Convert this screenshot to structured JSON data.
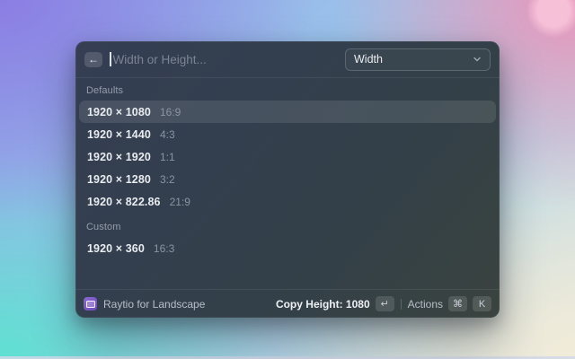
{
  "window": {
    "header": {
      "back_icon": "←",
      "search_placeholder": "Width or Height...",
      "dropdown": {
        "value": "Width"
      }
    },
    "sections": [
      {
        "label": "Defaults",
        "items": [
          {
            "size": "1920 × 1080",
            "ratio": "16:9",
            "selected": true
          },
          {
            "size": "1920 × 1440",
            "ratio": "4:3",
            "selected": false
          },
          {
            "size": "1920 × 1920",
            "ratio": "1:1",
            "selected": false
          },
          {
            "size": "1920 × 1280",
            "ratio": "3:2",
            "selected": false
          },
          {
            "size": "1920 × 822.86",
            "ratio": "21:9",
            "selected": false
          }
        ]
      },
      {
        "label": "Custom",
        "items": [
          {
            "size": "1920 × 360",
            "ratio": "16:3",
            "selected": false
          }
        ]
      }
    ],
    "footer": {
      "app_icon": "aspect-ratio-icon",
      "app_name": "Raytio for Landscape",
      "primary_action": "Copy Height: 1080",
      "primary_key": "↵",
      "actions_label": "Actions",
      "actions_keys": [
        "⌘",
        "K"
      ]
    }
  },
  "colors": {
    "accent_purple": "#7b5cc9",
    "window_bg": "#343e4d",
    "selected_row": "rgba(255,255,255,0.10)",
    "primary_text": "#e9ecef",
    "secondary_text": "#8b93a0"
  }
}
